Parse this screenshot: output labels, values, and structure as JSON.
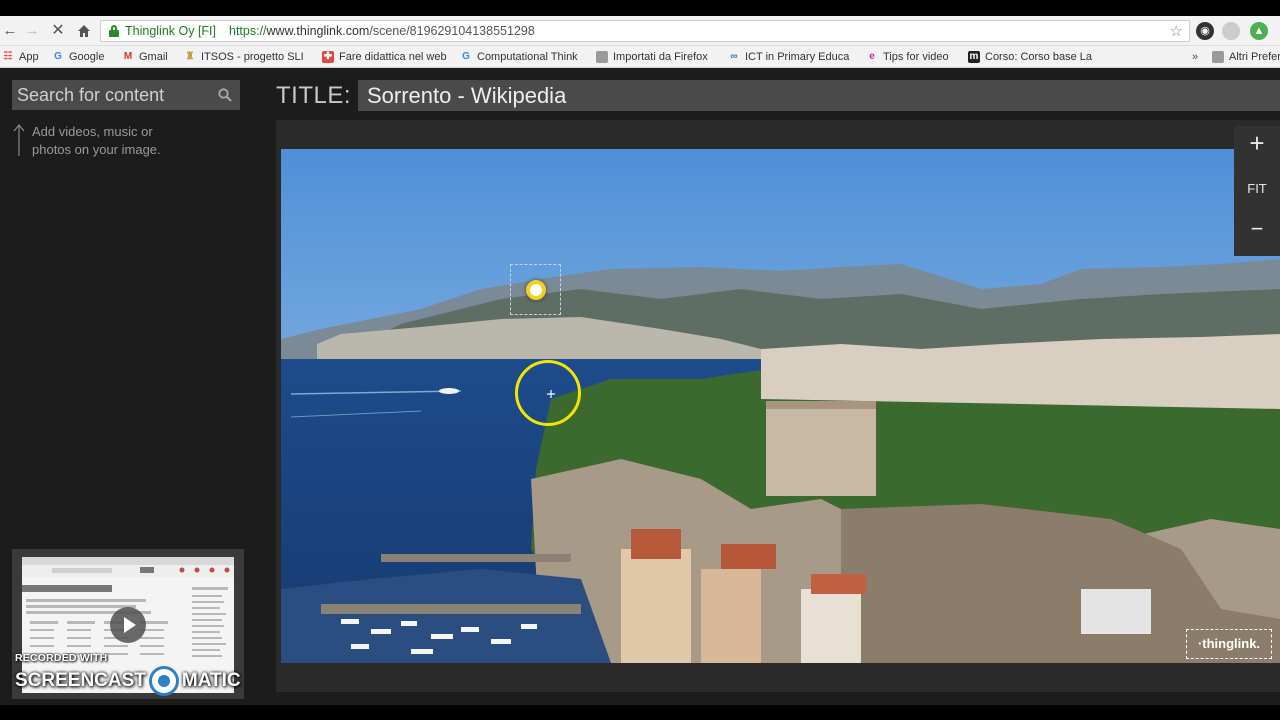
{
  "browser": {
    "site_identity": "Thinglink Oy [FI]",
    "url_scheme": "https://",
    "url_host": "www.thinglink.com",
    "url_path": "/scene/819629104138551298"
  },
  "bookmarks": [
    {
      "label": "App",
      "icon": "apps-grid-icon",
      "color": "#e8453c"
    },
    {
      "label": "Google",
      "icon": "google-g-icon",
      "color": "#4285f4"
    },
    {
      "label": "Gmail",
      "icon": "gmail-icon",
      "color": "#d93025"
    },
    {
      "label": "ITSOS - progetto SLI",
      "icon": "itsos-icon",
      "color": "#c8a040"
    },
    {
      "label": "Fare didattica nel web",
      "icon": "puzzle-icon",
      "color": "#e04848"
    },
    {
      "label": "Computational Think",
      "icon": "google-g-icon",
      "color": "#4285f4"
    },
    {
      "label": "Importati da Firefox",
      "icon": "folder-icon",
      "color": "#8a8a8a"
    },
    {
      "label": "ICT in Primary Educa",
      "icon": "coursera-icon",
      "color": "#2a73cc"
    },
    {
      "label": "Tips for video",
      "icon": "edx-icon",
      "color": "#c0308a"
    },
    {
      "label": "Corso: Corso base La",
      "icon": "m-icon",
      "color": "#222222"
    },
    {
      "label": "Altri Preferiti",
      "icon": "folder-icon",
      "color": "#8a8a8a"
    }
  ],
  "sidebar": {
    "search_placeholder": "Search for content",
    "hint_text": "Add videos, music or photos on your image."
  },
  "header": {
    "title_label": "TITLE:",
    "title_value": "Sorrento - Wikipedia"
  },
  "zoom": {
    "plus": "+",
    "fit": "FIT",
    "minus": "−"
  },
  "watermark": {
    "logo": "·thinglink.",
    "recorded": "RECORDED WITH",
    "brand_left": "SCREENCAST",
    "brand_right": "MATIC"
  },
  "colors": {
    "accent_tag": "#f0d020",
    "cursor_ring": "#f2e600"
  }
}
